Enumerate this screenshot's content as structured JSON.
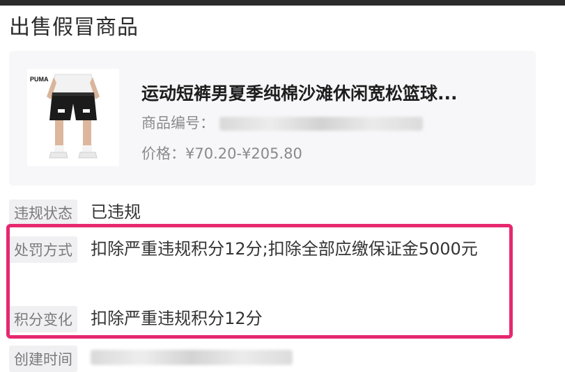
{
  "page": {
    "title": "出售假冒商品"
  },
  "product": {
    "name": "运动短裤男夏季纯棉沙滩休闲宽松篮球...",
    "code_label": "商品编号：",
    "price": "价格：¥70.20-¥205.80",
    "image": {
      "icon": "shorts-product-image",
      "brand_text": "PUMA"
    }
  },
  "violation": {
    "status_label": "违规状态",
    "status_value": "已违规",
    "penalty_label": "处罚方式",
    "penalty_value": "扣除严重违规积分12分;扣除全部应缴保证金5000元",
    "points_label": "积分变化",
    "points_value": "扣除严重违规积分12分",
    "created_label": "创建时间"
  },
  "colors": {
    "highlight": "#e6286f",
    "card_bg": "#f7f7f9",
    "label_bg": "#f0f0f2"
  }
}
